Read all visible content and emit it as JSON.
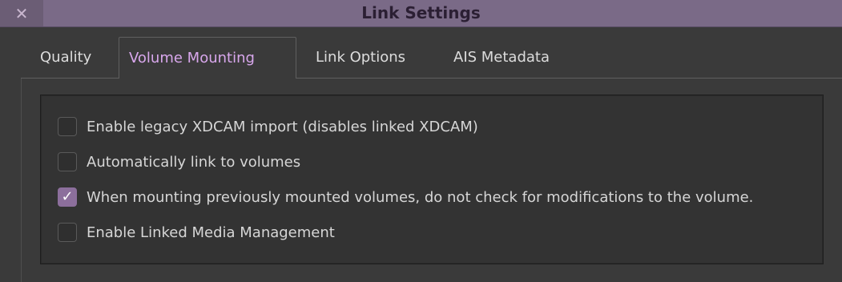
{
  "window": {
    "title": "Link Settings",
    "close_glyph": "✕"
  },
  "tabs": [
    {
      "label": "Quality",
      "active": false
    },
    {
      "label": "Volume Mounting",
      "active": true
    },
    {
      "label": "Link Options",
      "active": false
    },
    {
      "label": "AIS Metadata",
      "active": false
    }
  ],
  "options": [
    {
      "label": "Enable legacy XDCAM import (disables linked XDCAM)",
      "checked": false
    },
    {
      "label": "Automatically link to volumes",
      "checked": false
    },
    {
      "label": "When mounting previously mounted volumes, do not check for modifications to the volume.",
      "checked": true
    },
    {
      "label": "Enable Linked Media Management",
      "checked": false
    }
  ],
  "colors": {
    "accent": "#d8a7ec",
    "checkbox_checked": "#8c6f9c",
    "titlebar": "#7a6a87"
  },
  "icons": {
    "close": "close-icon",
    "check": "checkmark-icon"
  }
}
